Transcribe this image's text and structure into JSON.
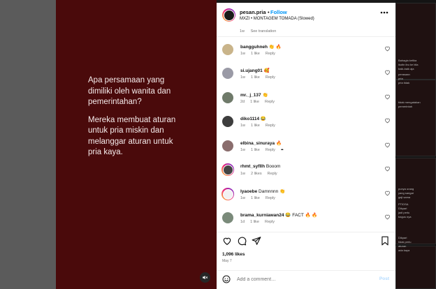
{
  "post": {
    "username": "pesan.pria",
    "separator": "•",
    "follow_label": "Follow",
    "audio": "MXZI • MONTAGEM TOMADA (Slowed)",
    "more_icon": "more-icon",
    "caption_age": "1w",
    "see_translation": "See translation"
  },
  "media": {
    "paragraph_1": "Apa persamaan yang\ndimiliki oleh wanita dan\npemerintahan?",
    "paragraph_2": "Mereka membuat aturan\nuntuk pria miskin dan\nmelanggar aturan untuk\npria kaya.",
    "background": "#4a0a0b",
    "mute_icon": "speaker-muted-icon"
  },
  "comments": [
    {
      "user": "bangguhneh",
      "text": "👏 🔥",
      "age": "1w",
      "likes": "1 like",
      "reply": "Reply",
      "avatar_color": "#c9b48a",
      "ring": false
    },
    {
      "user": "si.ujang01",
      "text": "🥰",
      "age": "1w",
      "likes": "1 like",
      "reply": "Reply",
      "avatar_color": "#9a9aa6",
      "ring": false
    },
    {
      "user": "mr._j_137",
      "text": "👏",
      "age": "2d",
      "likes": "1 like",
      "reply": "Reply",
      "avatar_color": "#6f7a6a",
      "ring": false
    },
    {
      "user": "diko1114",
      "text": "😂",
      "age": "1w",
      "likes": "1 like",
      "reply": "Reply",
      "avatar_color": "#3d3d3d",
      "ring": false
    },
    {
      "user": "elbina_sinuraya",
      "text": "🔥",
      "age": "1w",
      "likes": "1 like",
      "reply": "Reply",
      "avatar_color": "#8a6d6d",
      "ring": false,
      "more": "•••"
    },
    {
      "user": "rhmt_syfllh",
      "text": "Booom",
      "age": "1w",
      "likes": "2 likes",
      "reply": "Reply",
      "avatar_color": "#444",
      "ring": true
    },
    {
      "user": "lyaoebe",
      "text": "Damnnnn 👏",
      "age": "1w",
      "likes": "1 like",
      "reply": "Reply",
      "avatar_color": "#e8e8e8",
      "ring": true
    },
    {
      "user": "brama_kurniawan24",
      "text": "😂 FACT 🔥 🔥",
      "age": "1d",
      "likes": "1 like",
      "reply": "Reply",
      "avatar_color": "#7a8a7a",
      "ring": false
    }
  ],
  "footer": {
    "likes": "1,096 likes",
    "date": "May 7",
    "comment_placeholder": "Add a comment…",
    "post_label": "Post"
  },
  "background_feed": {
    "snippets": [
      [
        "Bahagia ketika",
        "ikutin ibu ke bila",
        "baik-baik aja"
      ],
      [
        "perasaan",
        "pria",
        "pria tidak"
      ],
      [
        "tidak mengatakan",
        "pemerintah"
      ],
      [
        "punya orang",
        "yang sangat",
        "gaji sama"
      ],
      [
        "PTIDSA",
        "Dikpari",
        "jadi perlu",
        "bagus nya"
      ],
      [
        "Dikpari",
        "tidak perlu",
        "aturan",
        "ada kaya"
      ]
    ]
  }
}
